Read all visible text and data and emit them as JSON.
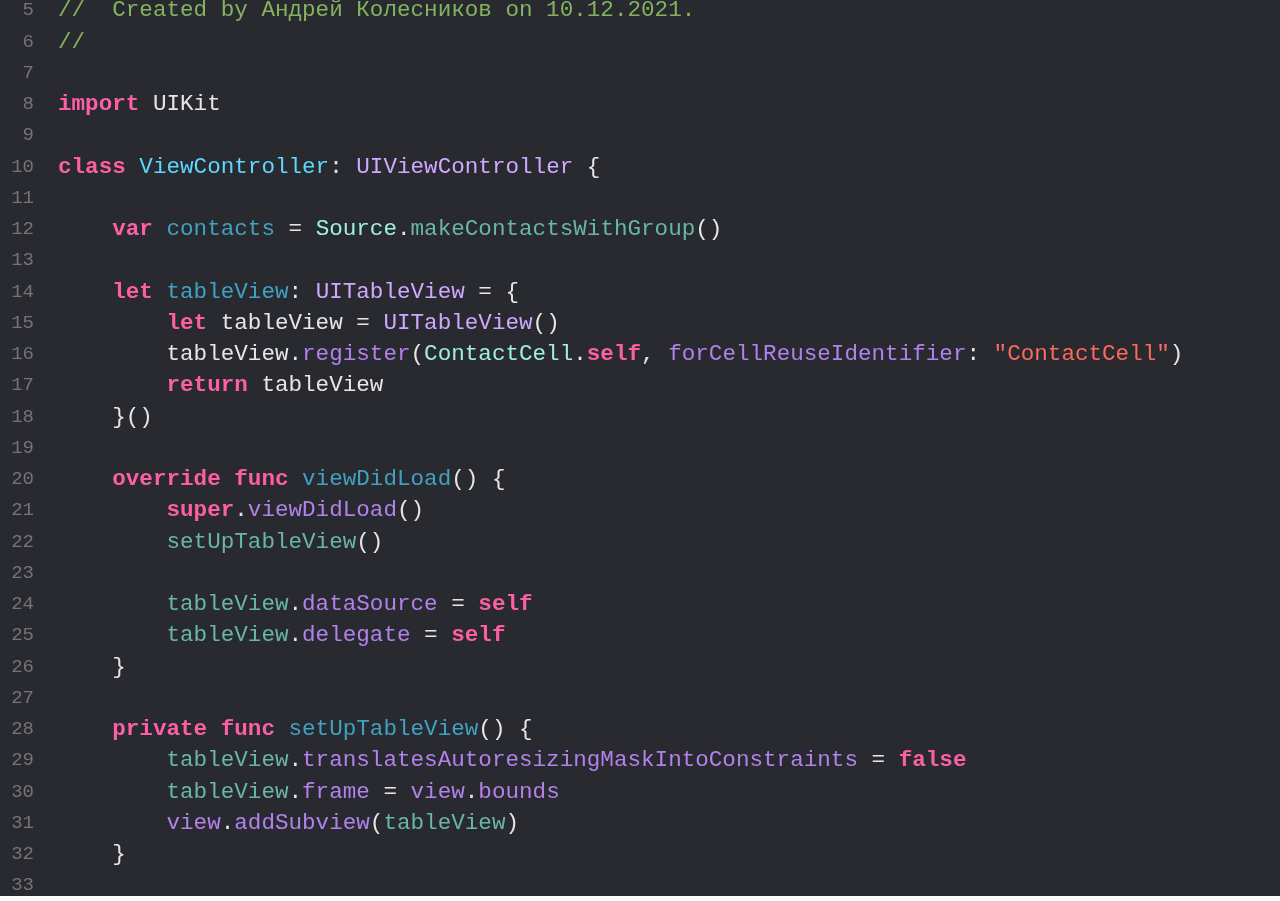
{
  "editor": {
    "lines": [
      {
        "number": "5",
        "code": [
          {
            "t": "//  Created by Андрей Колесников on 10.12.2021.",
            "kind": "comment"
          }
        ]
      },
      {
        "number": "6",
        "code": [
          {
            "t": "//",
            "kind": "comment"
          }
        ]
      },
      {
        "number": "7"
      },
      {
        "number": "8",
        "code": [
          {
            "t": "import",
            "kind": "keyword"
          },
          {
            "t": " UIKit",
            "kind": "plain"
          }
        ]
      },
      {
        "number": "9"
      },
      {
        "number": "10",
        "code": [
          {
            "t": "class",
            "kind": "keyword"
          },
          {
            "t": " ViewController",
            "kind": "type_decl"
          },
          {
            "t": ": ",
            "kind": "plain"
          },
          {
            "t": "UIViewController",
            "kind": "sys_type"
          },
          {
            "t": " {",
            "kind": "plain"
          }
        ]
      },
      {
        "number": "11"
      },
      {
        "number": "12",
        "code": [
          {
            "t": "    var",
            "kind": "keyword"
          },
          {
            "t": " contacts",
            "kind": "decl"
          },
          {
            "t": " = ",
            "kind": "plain"
          },
          {
            "t": "Source",
            "kind": "proj_type"
          },
          {
            "t": ".",
            "kind": "plain"
          },
          {
            "t": "makeContactsWithGroup",
            "kind": "proj_member"
          },
          {
            "t": "()",
            "kind": "plain"
          }
        ]
      },
      {
        "number": "13"
      },
      {
        "number": "14",
        "code": [
          {
            "t": "    let",
            "kind": "keyword"
          },
          {
            "t": " tableView",
            "kind": "decl"
          },
          {
            "t": ": ",
            "kind": "plain"
          },
          {
            "t": "UITableView",
            "kind": "sys_type"
          },
          {
            "t": " = {",
            "kind": "plain"
          }
        ]
      },
      {
        "number": "15",
        "code": [
          {
            "t": "        let",
            "kind": "keyword"
          },
          {
            "t": " tableView = ",
            "kind": "plain"
          },
          {
            "t": "UITableView",
            "kind": "sys_type"
          },
          {
            "t": "()",
            "kind": "plain"
          }
        ]
      },
      {
        "number": "16",
        "code": [
          {
            "t": "        tableView.",
            "kind": "plain"
          },
          {
            "t": "register",
            "kind": "sys_member"
          },
          {
            "t": "(",
            "kind": "plain"
          },
          {
            "t": "ContactCell",
            "kind": "proj_type"
          },
          {
            "t": ".",
            "kind": "plain"
          },
          {
            "t": "self",
            "kind": "keyword"
          },
          {
            "t": ", ",
            "kind": "plain"
          },
          {
            "t": "forCellReuseIdentifier",
            "kind": "sys_member"
          },
          {
            "t": ": ",
            "kind": "plain"
          },
          {
            "t": "\"ContactCell\"",
            "kind": "string"
          },
          {
            "t": ")",
            "kind": "plain"
          }
        ]
      },
      {
        "number": "17",
        "code": [
          {
            "t": "        return",
            "kind": "keyword"
          },
          {
            "t": " tableView",
            "kind": "plain"
          }
        ]
      },
      {
        "number": "18",
        "code": [
          {
            "t": "    }()",
            "kind": "plain"
          }
        ]
      },
      {
        "number": "19"
      },
      {
        "number": "20",
        "code": [
          {
            "t": "    override func",
            "kind": "keyword"
          },
          {
            "t": " viewDidLoad",
            "kind": "decl"
          },
          {
            "t": "() {",
            "kind": "plain"
          }
        ]
      },
      {
        "number": "21",
        "code": [
          {
            "t": "        super",
            "kind": "keyword"
          },
          {
            "t": ".",
            "kind": "plain"
          },
          {
            "t": "viewDidLoad",
            "kind": "sys_member"
          },
          {
            "t": "()",
            "kind": "plain"
          }
        ]
      },
      {
        "number": "22",
        "code": [
          {
            "t": "        setUpTableView",
            "kind": "proj_member"
          },
          {
            "t": "()",
            "kind": "plain"
          }
        ]
      },
      {
        "number": "23"
      },
      {
        "number": "24",
        "code": [
          {
            "t": "        tableView",
            "kind": "proj_member"
          },
          {
            "t": ".",
            "kind": "plain"
          },
          {
            "t": "dataSource",
            "kind": "sys_member"
          },
          {
            "t": " = ",
            "kind": "plain"
          },
          {
            "t": "self",
            "kind": "keyword"
          }
        ]
      },
      {
        "number": "25",
        "code": [
          {
            "t": "        tableView",
            "kind": "proj_member"
          },
          {
            "t": ".",
            "kind": "plain"
          },
          {
            "t": "delegate",
            "kind": "sys_member"
          },
          {
            "t": " = ",
            "kind": "plain"
          },
          {
            "t": "self",
            "kind": "keyword"
          }
        ]
      },
      {
        "number": "26",
        "code": [
          {
            "t": "    }",
            "kind": "plain"
          }
        ]
      },
      {
        "number": "27"
      },
      {
        "number": "28",
        "code": [
          {
            "t": "    private func",
            "kind": "keyword"
          },
          {
            "t": " setUpTableView",
            "kind": "decl"
          },
          {
            "t": "() {",
            "kind": "plain"
          }
        ]
      },
      {
        "number": "29",
        "code": [
          {
            "t": "        tableView",
            "kind": "proj_member"
          },
          {
            "t": ".",
            "kind": "plain"
          },
          {
            "t": "translatesAutoresizingMaskIntoConstraints",
            "kind": "sys_member"
          },
          {
            "t": " = ",
            "kind": "plain"
          },
          {
            "t": "false",
            "kind": "keyword"
          }
        ]
      },
      {
        "number": "30",
        "code": [
          {
            "t": "        tableView",
            "kind": "proj_member"
          },
          {
            "t": ".",
            "kind": "plain"
          },
          {
            "t": "frame",
            "kind": "sys_member"
          },
          {
            "t": " = ",
            "kind": "plain"
          },
          {
            "t": "view",
            "kind": "sys_member"
          },
          {
            "t": ".",
            "kind": "plain"
          },
          {
            "t": "bounds",
            "kind": "sys_member"
          }
        ]
      },
      {
        "number": "31",
        "code": [
          {
            "t": "        view",
            "kind": "sys_member"
          },
          {
            "t": ".",
            "kind": "plain"
          },
          {
            "t": "addSubview",
            "kind": "sys_member"
          },
          {
            "t": "(",
            "kind": "plain"
          },
          {
            "t": "tableView",
            "kind": "proj_member"
          },
          {
            "t": ")",
            "kind": "plain"
          }
        ]
      },
      {
        "number": "32",
        "code": [
          {
            "t": "    }",
            "kind": "plain"
          }
        ]
      },
      {
        "number": "33"
      }
    ]
  }
}
